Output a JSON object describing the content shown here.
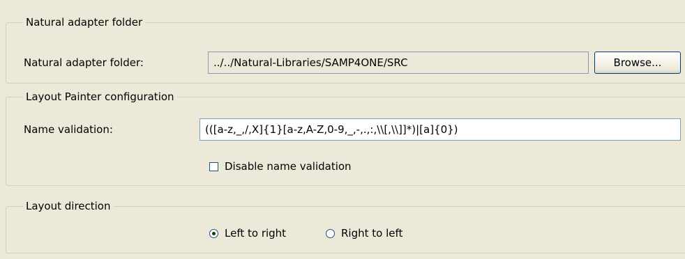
{
  "adapter": {
    "group_title": "Natural adapter folder",
    "field_label": "Natural adapter folder:",
    "field_value": "../../Natural-Libraries/SAMP4ONE/SRC",
    "browse_label": "Browse..."
  },
  "painter": {
    "group_title": "Layout Painter configuration",
    "validation_label": "Name validation:",
    "validation_value": "(([a-z,_,/,X]{1}[a-z,A-Z,0-9,_,-,.,:,\\\\[,\\\\]]*)|[a]{0})",
    "disable_label": "Disable name validation",
    "disable_checked": false
  },
  "direction": {
    "group_title": "Layout direction",
    "options": [
      {
        "label": "Left to right",
        "selected": true
      },
      {
        "label": "Right to left",
        "selected": false
      }
    ]
  }
}
